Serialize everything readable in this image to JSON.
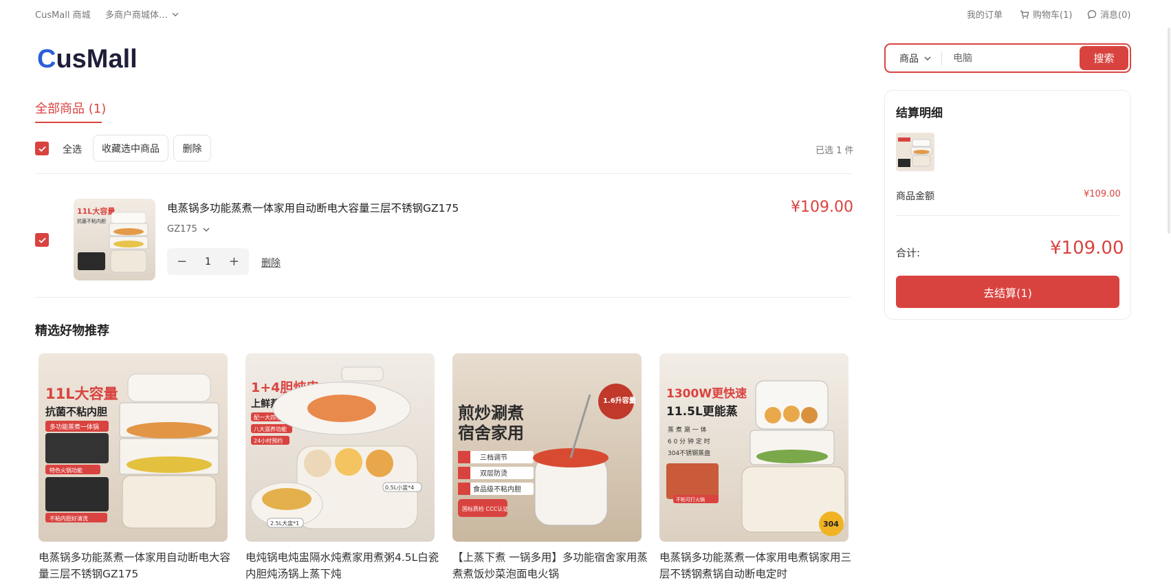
{
  "topbar": {
    "site_name": "CusMall 商城",
    "store_selector": "多商户商城体…",
    "my_orders": "我的订单",
    "cart": "购物车(1)",
    "messages": "消息(0)"
  },
  "logo": {
    "text_c": "C",
    "text_rest": "usMall"
  },
  "search": {
    "category": "商品",
    "placeholder": "电脑",
    "button": "搜索"
  },
  "tabs": {
    "all": "全部商品 (1)"
  },
  "toolbar": {
    "select_all": "全选",
    "favorite_selected": "收藏选中商品",
    "delete": "删除",
    "selected_count": "已选 1 件"
  },
  "cart_item": {
    "title": "电蒸锅多功能蒸煮一体家用自动断电大容量三层不锈钢GZ175",
    "variant": "GZ175",
    "quantity": "1",
    "delete": "删除",
    "price": "¥109.00",
    "thumb_text_1": "11L大容量",
    "thumb_text_2": "抗菌不粘内胆"
  },
  "recommendations": {
    "title": "精选好物推荐",
    "items": [
      {
        "name": "电蒸锅多功能蒸煮一体家用自动断电大容量三层不锈钢GZ175",
        "img_line1": "11L大容量",
        "img_line2": "抗菌不粘内胆",
        "tag1": "多功能蒸煮一体锅",
        "tag2": "特色火锅功能",
        "tag3": "不粘内胆好清洗"
      },
      {
        "name": "电炖锅电炖盅隔水炖煮家用煮粥4.5L白瓷内胆炖汤锅上蒸下炖",
        "img_line1": "1+4胆炖盅",
        "img_line2": "上鲜蒸下精炖",
        "tag1": "配一大四小白瓷盅",
        "tag2": "八大滋养功能",
        "tag3": "24小时预约",
        "label_a": "2.5L大盅*1",
        "label_b": "0.5L小盅*4"
      },
      {
        "name": "【上蒸下煮 一锅多用】多功能宿舍家用蒸煮煮饭炒菜泡面电火锅",
        "img_line1": "煎炒涮煮",
        "img_line2": "宿舍家用",
        "tag1": "三档调节",
        "tag2": "双层防烫",
        "tag3": "食品级不粘内胆",
        "badge": "1.6升容量",
        "cert": "国标质检 CCC认证"
      },
      {
        "name": "电蒸锅多功能蒸煮一体家用电煮锅家用三层不锈钢煮锅自动断电定时",
        "img_line1": "1300W更快速",
        "img_line2": "11.5L更能蒸",
        "tag1": "蒸 煮 涮 一 体",
        "tag2": "6 0 分 钟 定 时",
        "tag3": "304不锈钢蒸盘",
        "tag4": "不粘可打火锅",
        "badge": "304"
      }
    ]
  },
  "summary": {
    "title": "结算明细",
    "goods_amount_label": "商品金额",
    "goods_amount": "¥109.00",
    "total_label": "合计:",
    "total": "¥109.00",
    "checkout": "去结算(1)"
  },
  "colors": {
    "accent": "#d9433f",
    "logo_blue": "#2b5fd9",
    "logo_dark": "#1f1f3a"
  }
}
